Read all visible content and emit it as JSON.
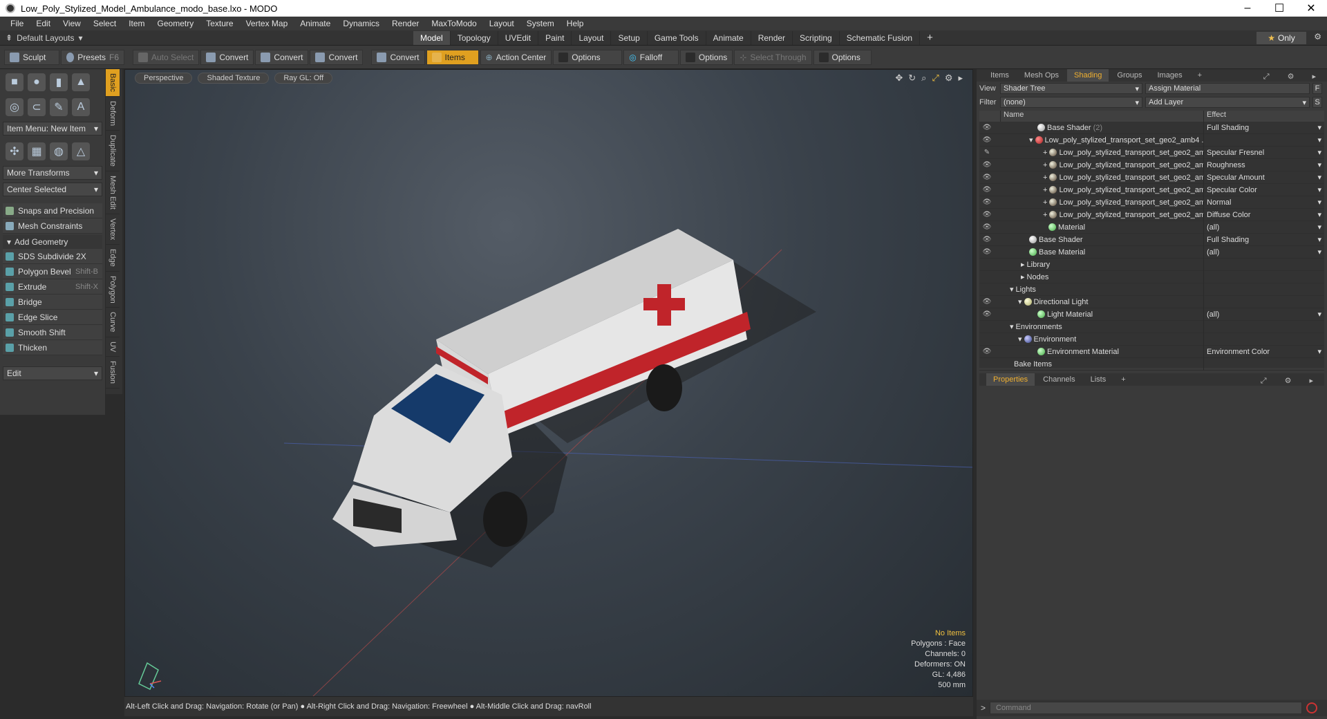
{
  "window": {
    "title": "Low_Poly_Stylized_Model_Ambulance_modo_base.lxo - MODO"
  },
  "menu": [
    "File",
    "Edit",
    "View",
    "Select",
    "Item",
    "Geometry",
    "Texture",
    "Vertex Map",
    "Animate",
    "Dynamics",
    "Render",
    "MaxToModo",
    "Layout",
    "System",
    "Help"
  ],
  "layout": {
    "selector": "Default Layouts",
    "tabs": [
      "Model",
      "Topology",
      "UVEdit",
      "Paint",
      "Layout",
      "Setup",
      "Game Tools",
      "Animate",
      "Render",
      "Scripting",
      "Schematic Fusion"
    ],
    "active_tab": "Model",
    "only_label": "Only"
  },
  "toolbar": {
    "sculpt": "Sculpt",
    "presets": "Presets",
    "presets_key": "F6",
    "auto_select": "Auto Select",
    "convert": "Convert",
    "items": "Items",
    "action_center": "Action Center",
    "options": "Options",
    "falloff": "Falloff",
    "select_through": "Select Through"
  },
  "left": {
    "item_menu": "Item Menu: New Item",
    "more_transforms": "More Transforms",
    "center_selected": "Center Selected",
    "snaps": "Snaps and Precision",
    "constraints": "Mesh Constraints",
    "add_geometry": "Add Geometry",
    "tools": [
      {
        "label": "SDS Subdivide 2X",
        "shortcut": ""
      },
      {
        "label": "Polygon Bevel",
        "shortcut": "Shift-B"
      },
      {
        "label": "Extrude",
        "shortcut": "Shift-X"
      },
      {
        "label": "Bridge",
        "shortcut": ""
      },
      {
        "label": "Edge Slice",
        "shortcut": ""
      },
      {
        "label": "Smooth Shift",
        "shortcut": ""
      },
      {
        "label": "Thicken",
        "shortcut": ""
      }
    ],
    "edit": "Edit",
    "vtabs": [
      "Basic",
      "Deform",
      "Duplicate",
      "Mesh Edit",
      "Vertex",
      "Edge",
      "Polygon",
      "Curve",
      "UV",
      "Fusion"
    ]
  },
  "viewport": {
    "view": "Perspective",
    "shading": "Shaded Texture",
    "raygl": "Ray GL: Off",
    "stats": {
      "no_items": "No Items",
      "polygons": "Polygons : Face",
      "channels": "Channels: 0",
      "deformers": "Deformers: ON",
      "gl": "GL: 4,486",
      "size": "500 mm"
    }
  },
  "status": "Alt-Left Click and Drag: Navigation: Rotate (or Pan) ● Alt-Right Click and Drag: Navigation: Freewheel ● Alt-Middle Click and Drag: navRoll",
  "right": {
    "tabs": [
      "Items",
      "Mesh Ops",
      "Shading",
      "Groups",
      "Images"
    ],
    "active_tab": "Shading",
    "view_label": "View",
    "view_value": "Shader Tree",
    "assign": "Assign Material",
    "assign_key": "F",
    "filter_label": "Filter",
    "filter_value": "(none)",
    "add_layer": "Add Layer",
    "add_key": "S",
    "col_name": "Name",
    "col_effect": "Effect",
    "rows": [
      {
        "name": "Base Shader",
        "extra": "(2)",
        "effect": "Full Shading"
      },
      {
        "name": "Low_poly_stylized_transport_set_geo2_amb4 ...",
        "extra": "",
        "effect": ""
      },
      {
        "name": "Low_poly_stylized_transport_set_geo2_am ...",
        "extra": "",
        "effect": "Specular Fresnel"
      },
      {
        "name": "Low_poly_stylized_transport_set_geo2_am ...",
        "extra": "",
        "effect": "Roughness"
      },
      {
        "name": "Low_poly_stylized_transport_set_geo2_am ...",
        "extra": "",
        "effect": "Specular Amount"
      },
      {
        "name": "Low_poly_stylized_transport_set_geo2_am ...",
        "extra": "",
        "effect": "Specular Color"
      },
      {
        "name": "Low_poly_stylized_transport_set_geo2_am ...",
        "extra": "",
        "effect": "Normal"
      },
      {
        "name": "Low_poly_stylized_transport_set_geo2_am ...",
        "extra": "",
        "effect": "Diffuse Color"
      },
      {
        "name": "Material",
        "extra": "",
        "effect": "(all)"
      },
      {
        "name": "Base Shader",
        "extra": "",
        "effect": "Full Shading"
      },
      {
        "name": "Base Material",
        "extra": "",
        "effect": "(all)"
      },
      {
        "name": "Library",
        "extra": "",
        "effect": ""
      },
      {
        "name": "Nodes",
        "extra": "",
        "effect": ""
      },
      {
        "name": "Lights",
        "extra": "",
        "effect": ""
      },
      {
        "name": "Directional Light",
        "extra": "",
        "effect": ""
      },
      {
        "name": "Light Material",
        "extra": "",
        "effect": "(all)"
      },
      {
        "name": "Environments",
        "extra": "",
        "effect": ""
      },
      {
        "name": "Environment",
        "extra": "",
        "effect": ""
      },
      {
        "name": "Environment Material",
        "extra": "",
        "effect": "Environment Color"
      },
      {
        "name": "Bake Items",
        "extra": "",
        "effect": ""
      }
    ],
    "prop_tabs": [
      "Properties",
      "Channels",
      "Lists"
    ],
    "command_placeholder": "Command"
  }
}
